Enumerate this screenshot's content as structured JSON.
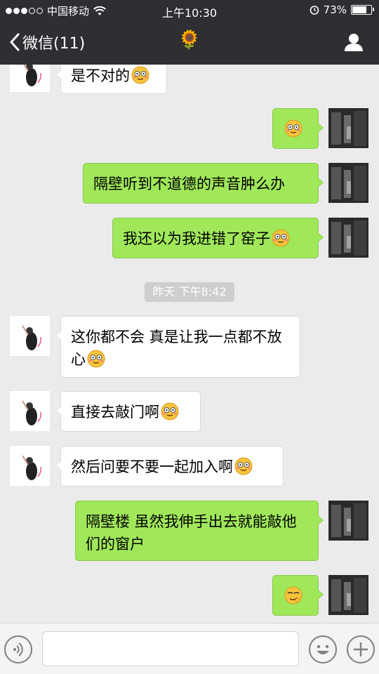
{
  "status_bar": {
    "carrier": "中国移动",
    "time": "上午10:30",
    "battery": "73%",
    "battery_level": 0.73
  },
  "nav": {
    "back_label": "微信(11)",
    "title_emoji": "🌻",
    "profile_icon": "person-icon"
  },
  "messages": [
    {
      "side": "in",
      "text": "是不对的",
      "emoji": "flushed-face"
    },
    {
      "side": "out",
      "text": "",
      "emoji": "flushed-face"
    },
    {
      "side": "out",
      "text": "隔壁听到不道德的声音肿么办",
      "emoji": ""
    },
    {
      "side": "out",
      "text": "我还以为我进错了窑子",
      "emoji": "flushed-face"
    },
    {
      "side": "in",
      "text": "这你都不会 真是让我一点都不放心",
      "emoji": "flushed-face"
    },
    {
      "side": "in",
      "text": "直接去敲门啊",
      "emoji": "flushed-face"
    },
    {
      "side": "in",
      "text": "然后问要不要一起加入啊",
      "emoji": "flushed-face"
    },
    {
      "side": "out",
      "text": "隔壁楼 虽然我伸手出去就能敲他们的窗户",
      "emoji": ""
    },
    {
      "side": "out",
      "text": "",
      "emoji": "smirk-face"
    }
  ],
  "timestamp": "昨天 下午8:42",
  "input_bar": {
    "voice_icon": "voice-icon",
    "emoji_icon": "emoji-face-icon",
    "plus_icon": "plus-icon",
    "text_value": ""
  },
  "colors": {
    "header": "#2e2e33",
    "outgoing": "#a0e75a",
    "incoming": "#ffffff",
    "background": "#ebebeb"
  }
}
